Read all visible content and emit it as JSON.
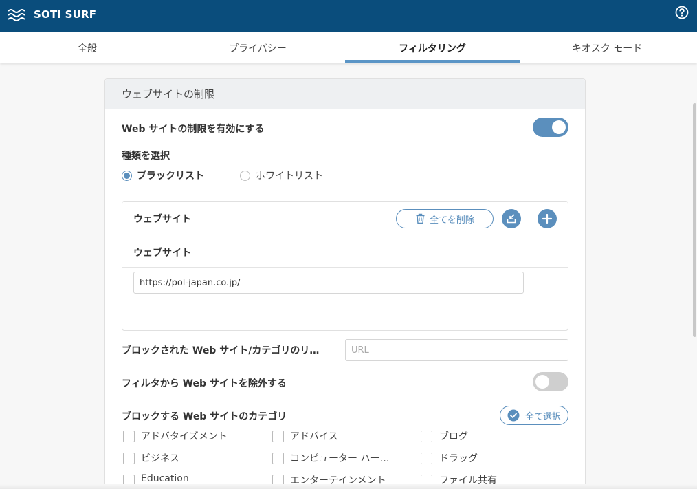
{
  "app": {
    "title": "SOTI SURF"
  },
  "tabs": [
    {
      "label": "全般"
    },
    {
      "label": "プライバシー"
    },
    {
      "label": "フィルタリング"
    },
    {
      "label": "キオスク モード"
    }
  ],
  "active_tab": 2,
  "panel": {
    "header": "ウェブサイトの制限",
    "enable_label": "Web サイトの制限を有効にする",
    "enable_on": true,
    "type_label": "種類を選択",
    "radio_blacklist": "ブラックリスト",
    "radio_whitelist": "ホワイトリスト",
    "selected_type": "blacklist",
    "website_box": {
      "title": "ウェブサイト",
      "delete_all_label": "全てを削除",
      "column_header": "ウェブサイト",
      "entries": [
        "https://pol-japan.co.jp/"
      ]
    },
    "redirect_label": "ブロックされた Web サイト/カテゴリのリ…",
    "redirect_placeholder": "URL",
    "exclude_label": "フィルタから Web サイトを除外する",
    "exclude_on": false,
    "category_label": "ブロックする Web サイトのカテゴリ",
    "select_all_label": "全て選択",
    "categories": [
      "アドバタイズメント",
      "アドバイス",
      "ブログ",
      "ビジネス",
      "コンピューター ハー…",
      "ドラッグ",
      "Education",
      "エンターテインメント",
      "ファイル共有"
    ]
  },
  "colors": {
    "topbar": "#0a4d7c",
    "accent": "#5b8fbd"
  }
}
